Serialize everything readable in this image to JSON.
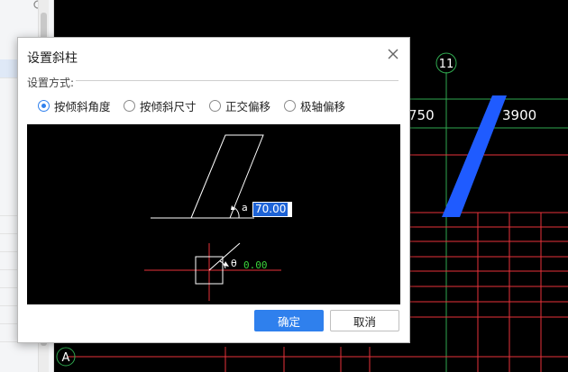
{
  "dialog": {
    "title": "设置斜柱",
    "group_label": "设置方式:",
    "options": [
      {
        "label": "按倾斜角度",
        "checked": true
      },
      {
        "label": "按倾斜尺寸",
        "checked": false
      },
      {
        "label": "正交偏移",
        "checked": false
      },
      {
        "label": "极轴偏移",
        "checked": false
      }
    ],
    "preview": {
      "alpha_symbol": "a",
      "alpha_value": "70.00",
      "theta_symbol": "θ",
      "theta_value": "0.00"
    },
    "ok_label": "确定",
    "cancel_label": "取消"
  },
  "canvas": {
    "axis_bubble_11": "11",
    "axis_bubble_a": "A",
    "dim_750": "750",
    "dim_3900": "3900"
  },
  "colors": {
    "accent": "#2f80ed",
    "grid_red": "#e8323a",
    "grid_green": "#2fa84f",
    "column_blue": "#1f5bff"
  },
  "icons": {
    "close": "close-icon",
    "search": "search-icon"
  }
}
